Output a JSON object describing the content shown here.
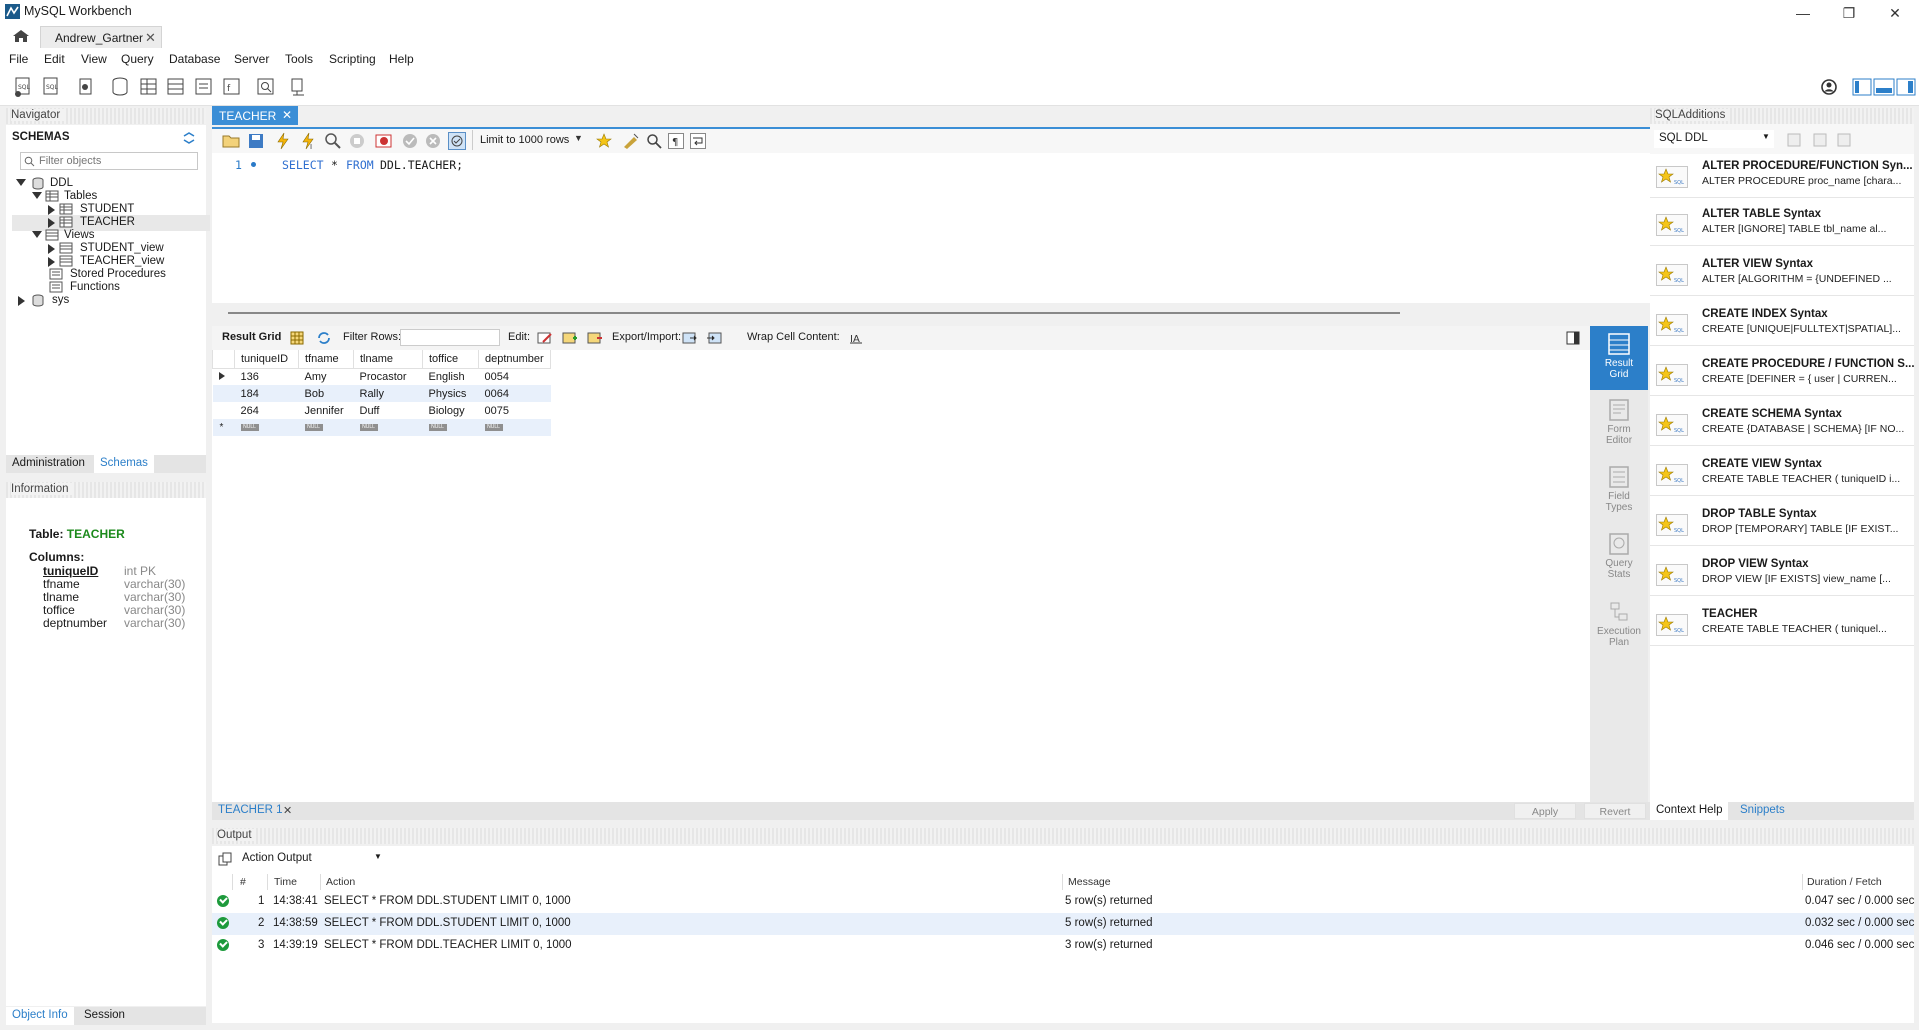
{
  "window": {
    "title": "MySQL Workbench"
  },
  "connection_tab": {
    "label": "Andrew_Gartner"
  },
  "menu": [
    "File",
    "Edit",
    "View",
    "Query",
    "Database",
    "Server",
    "Tools",
    "Scripting",
    "Help"
  ],
  "navigator": {
    "header": "Navigator",
    "schemas_title": "SCHEMAS",
    "filter_placeholder": "Filter objects",
    "tree": {
      "db": "DDL",
      "tables": "Tables",
      "table_items": [
        "STUDENT",
        "TEACHER"
      ],
      "views": "Views",
      "view_items": [
        "STUDENT_view",
        "TEACHER_view"
      ],
      "procs": "Stored Procedures",
      "funcs": "Functions",
      "sys": "sys"
    },
    "tabs": {
      "admin": "Administration",
      "schemas": "Schemas"
    }
  },
  "information": {
    "header": "Information",
    "table_label": "Table:",
    "table_name": "TEACHER",
    "columns_label": "Columns:",
    "columns": [
      {
        "name": "tuniqueID",
        "type": "int PK"
      },
      {
        "name": "tfname",
        "type": "varchar(30)"
      },
      {
        "name": "tlname",
        "type": "varchar(30)"
      },
      {
        "name": "toffice",
        "type": "varchar(30)"
      },
      {
        "name": "deptnumber",
        "type": "varchar(30)"
      }
    ],
    "tabs": {
      "object_info": "Object Info",
      "session": "Session"
    }
  },
  "editor": {
    "tab_label": "TEACHER",
    "limit": "Limit to 1000 rows",
    "line_number": "1",
    "sql_keyword": "SELECT",
    "sql_star": "*",
    "sql_from": "FROM",
    "sql_rest": "DDL.TEACHER;"
  },
  "result": {
    "toolbar": {
      "result_grid": "Result Grid",
      "filter_rows": "Filter Rows:",
      "edit": "Edit:",
      "export": "Export/Import:",
      "wrap": "Wrap Cell Content:"
    },
    "columns": [
      "tuniqueID",
      "tfname",
      "tlname",
      "toffice",
      "deptnumber"
    ],
    "rows": [
      [
        "136",
        "Amy",
        "Procastor",
        "English",
        "0054"
      ],
      [
        "184",
        "Bob",
        "Rally",
        "Physics",
        "0064"
      ],
      [
        "264",
        "Jennifer",
        "Duff",
        "Biology",
        "0075"
      ]
    ],
    "null_text": "NULL",
    "tab_label": "TEACHER 1",
    "apply": "Apply",
    "revert": "Revert",
    "side": {
      "result_grid": [
        "Result",
        "Grid"
      ],
      "form_editor": [
        "Form",
        "Editor"
      ],
      "field_types": [
        "Field",
        "Types"
      ],
      "query_stats": [
        "Query",
        "Stats"
      ],
      "execution_plan": [
        "Execution",
        "Plan"
      ]
    }
  },
  "sql_additions": {
    "header": "SQLAdditions",
    "dropdown": "SQL DDL",
    "snippets": [
      {
        "title": "ALTER PROCEDURE/FUNCTION Syn...",
        "sub": "ALTER PROCEDURE proc_name [chara..."
      },
      {
        "title": "ALTER TABLE Syntax",
        "sub": "ALTER [IGNORE] TABLE tbl_name     al..."
      },
      {
        "title": "ALTER VIEW Syntax",
        "sub": "ALTER     [ALGORITHM = {UNDEFINED ..."
      },
      {
        "title": "CREATE INDEX Syntax",
        "sub": "CREATE [UNIQUE|FULLTEXT|SPATIAL]..."
      },
      {
        "title": "CREATE PROCEDURE / FUNCTION S...",
        "sub": "CREATE     [DEFINER = { user | CURREN..."
      },
      {
        "title": "CREATE SCHEMA Syntax",
        "sub": "CREATE {DATABASE | SCHEMA} [IF NO..."
      },
      {
        "title": "CREATE VIEW Syntax",
        "sub": "CREATE TABLE TEACHER ( tuniqueID i..."
      },
      {
        "title": "DROP TABLE Syntax",
        "sub": "DROP [TEMPORARY] TABLE [IF EXIST..."
      },
      {
        "title": "DROP VIEW Syntax",
        "sub": "DROP VIEW [IF EXISTS]     view_name [..."
      },
      {
        "title": "TEACHER",
        "sub": "CREATE TABLE TEACHER (     tuniquel..."
      }
    ],
    "tabs": {
      "context_help": "Context Help",
      "snippets": "Snippets"
    }
  },
  "output": {
    "header": "Output",
    "selector": "Action Output",
    "columns": {
      "num": "#",
      "time": "Time",
      "action": "Action",
      "message": "Message",
      "duration": "Duration / Fetch"
    },
    "rows": [
      {
        "num": "1",
        "time": "14:38:41",
        "action": "SELECT * FROM DDL.STUDENT LIMIT 0, 1000",
        "message": "5 row(s) returned",
        "duration": "0.047 sec / 0.000 sec"
      },
      {
        "num": "2",
        "time": "14:38:59",
        "action": "SELECT * FROM DDL.STUDENT LIMIT 0, 1000",
        "message": "5 row(s) returned",
        "duration": "0.032 sec / 0.000 sec"
      },
      {
        "num": "3",
        "time": "14:39:19",
        "action": "SELECT * FROM DDL.TEACHER LIMIT 0, 1000",
        "message": "3 row(s) returned",
        "duration": "0.046 sec / 0.000 sec"
      }
    ]
  },
  "colors": {
    "accent": "#3b8ed6",
    "keyword": "#2f6fd0",
    "ok": "#1d9a3c",
    "info_table": "#1c8a1c"
  }
}
